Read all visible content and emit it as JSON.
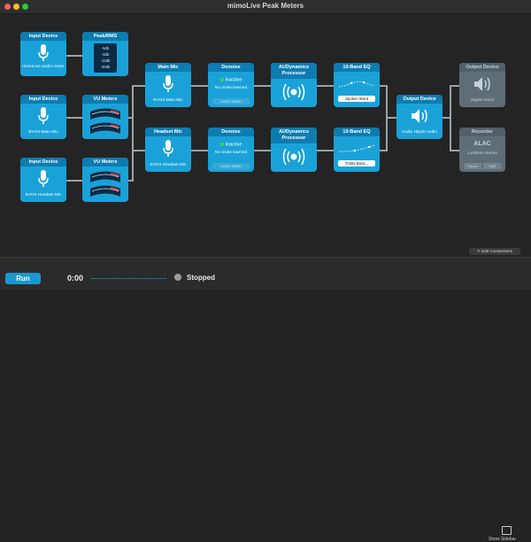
{
  "window": {
    "title": "mimoLive Peak Meters"
  },
  "colors": {
    "node": "#1aa2d8",
    "node_header": "#0e7cb0",
    "disabled_node": "#5f6e76",
    "status_active": "#3dd64e"
  },
  "nodes": {
    "input1": {
      "title": "Input Device",
      "caption": "mimoLive audio router"
    },
    "input2": {
      "title": "Input Device",
      "caption": "EVO4 Main Mic"
    },
    "input3": {
      "title": "Input Device",
      "caption": "EVO4 Headset Mic"
    },
    "peak": {
      "title": "Peak/RMS",
      "labels": [
        "-5db",
        "-9db",
        "-18db",
        "-36db"
      ]
    },
    "vu2": {
      "title": "VU Meters"
    },
    "vu3": {
      "title": "VU Meters"
    },
    "main_mic": {
      "title": "Main Mic",
      "caption": "EVO4 Main Mic"
    },
    "headset_mic": {
      "title": "Headset Mic",
      "caption": "EVO4 Headset Mic"
    },
    "denoise1": {
      "title": "Denoise",
      "status": "Inactive",
      "sub": "No noise learned",
      "button": "Learn Noise"
    },
    "denoise2": {
      "title": "Denoise",
      "status": "Inactive",
      "sub": "No noise learned",
      "button": "Learn Noise"
    },
    "au1": {
      "title": "AUDynamics Processor"
    },
    "au2": {
      "title": "AUDynamics Processor"
    },
    "eq1": {
      "title": "10-Band EQ",
      "preset": "Spoken Word"
    },
    "eq2": {
      "title": "10-Band EQ",
      "preset": "Treble Boos..."
    },
    "output_hijack": {
      "title": "Output Device",
      "caption": "Audio Hijack Audio"
    },
    "output_dock": {
      "title": "Output Device",
      "caption": "Elgato Dock"
    },
    "recorder": {
      "title": "Recorder",
      "format": "ALAC",
      "sub": "Lossless Stereo",
      "pause": "Pause",
      "split": "Split"
    }
  },
  "edit_connections": "Edit Connections",
  "bottom": {
    "run": "Run",
    "time": "0:00",
    "status": "Stopped",
    "show_sidebar": "Show Sidebar"
  }
}
